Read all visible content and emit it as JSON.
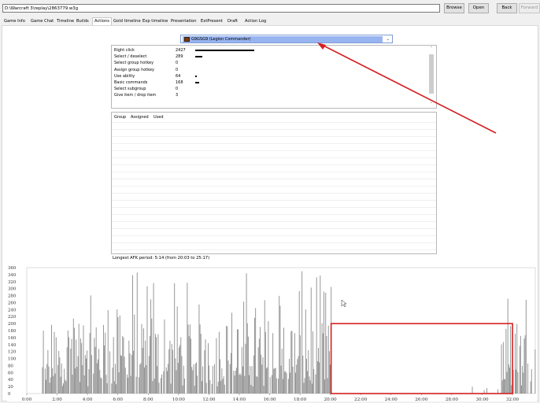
{
  "toolbar": {
    "path": "D:\\Warcraft 3\\replay\\2863779.w3g",
    "browse": "Browse",
    "open": "Open",
    "back": "Back",
    "forward": "Forward"
  },
  "tabs": [
    "Game Info",
    "Game Chat",
    "Timeline",
    "Builds",
    "Actions",
    "Gold timeline",
    "Exp timeline",
    "Presentation",
    "ExtPresent",
    "Draft",
    "Action Log"
  ],
  "active_tab": "Actions",
  "player": {
    "name": "G9GSG9 (Legion Commander)",
    "icon": "hero-portrait-icon"
  },
  "actions": {
    "rows": [
      {
        "label": "Right click",
        "count": "2427",
        "bar": 1.0
      },
      {
        "label": "Select / deselect",
        "count": "289",
        "bar": 0.12
      },
      {
        "label": "Select group hotkey",
        "count": "0",
        "bar": 0
      },
      {
        "label": "Assign group hotkey",
        "count": "0",
        "bar": 0
      },
      {
        "label": "Use ability",
        "count": "64",
        "bar": 0.026
      },
      {
        "label": "Basic commands",
        "count": "168",
        "bar": 0.07
      },
      {
        "label": "Select subgroup",
        "count": "0",
        "bar": 0
      },
      {
        "label": "Give item / drop item",
        "count": "3",
        "bar": 0
      }
    ]
  },
  "groups": {
    "headers": [
      "Group",
      "Assigned",
      "Used"
    ]
  },
  "apm": {
    "longest_afk": "Longest AFK period: 5:14 (from 20:03 to 25:17)"
  },
  "chart_data": {
    "type": "bar",
    "y_ticks": [
      "360",
      "340",
      "320",
      "300",
      "280",
      "260",
      "240",
      "220",
      "200",
      "180",
      "160",
      "140",
      "120",
      "100",
      "80",
      "60",
      "40",
      "20",
      "0"
    ],
    "x_ticks": [
      "0:00",
      "2:00",
      "4:00",
      "6:00",
      "8:00",
      "10:00",
      "12:00",
      "14:00",
      "16:00",
      "18:00",
      "20:00",
      "22:00",
      "24:00",
      "26:00",
      "28:00",
      "30:00",
      "32:00"
    ],
    "ylim": [
      0,
      360
    ],
    "xlim_minutes": [
      0,
      33.5
    ],
    "afk_window_minutes": [
      20.05,
      25.28
    ],
    "highlight_rect_minutes": [
      20.05,
      32.0
    ],
    "bar_color": "#8c8c8c",
    "highlight_color": "#d42020",
    "arrow_color": "#d42020"
  }
}
